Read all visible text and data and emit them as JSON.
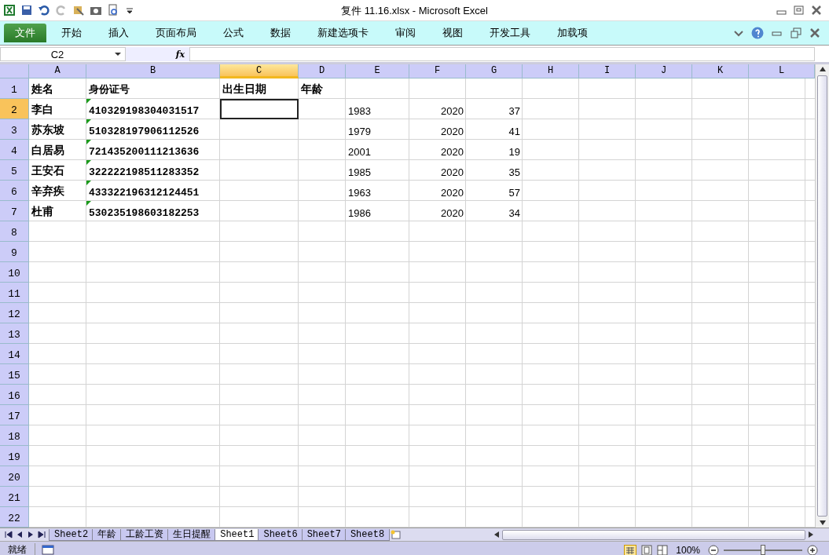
{
  "window": {
    "title": "复件 11.16.xlsx  -  Microsoft Excel"
  },
  "ribbon_tabs": [
    {
      "label": "文件",
      "kind": "file",
      "selected": false
    },
    {
      "label": "开始",
      "kind": "tab",
      "selected": false
    },
    {
      "label": "插入",
      "kind": "tab",
      "selected": false
    },
    {
      "label": "页面布局",
      "kind": "tab",
      "selected": false
    },
    {
      "label": "公式",
      "kind": "tab",
      "selected": false
    },
    {
      "label": "数据",
      "kind": "tab",
      "selected": false
    },
    {
      "label": "新建选项卡",
      "kind": "tab",
      "selected": false
    },
    {
      "label": "审阅",
      "kind": "tab",
      "selected": false
    },
    {
      "label": "视图",
      "kind": "tab",
      "selected": false
    },
    {
      "label": "开发工具",
      "kind": "tab",
      "selected": false
    },
    {
      "label": "加载项",
      "kind": "tab",
      "selected": false
    }
  ],
  "formula_bar": {
    "name_box": "C2",
    "function_symbol": "fx"
  },
  "columns": [
    {
      "label": "A",
      "selected": false
    },
    {
      "label": "B",
      "selected": false
    },
    {
      "label": "C",
      "selected": true
    },
    {
      "label": "D",
      "selected": false
    },
    {
      "label": "E",
      "selected": false
    },
    {
      "label": "F",
      "selected": false
    },
    {
      "label": "G",
      "selected": false
    },
    {
      "label": "H",
      "selected": false
    },
    {
      "label": "I",
      "selected": false
    },
    {
      "label": "J",
      "selected": false
    },
    {
      "label": "K",
      "selected": false
    },
    {
      "label": "L",
      "selected": false
    }
  ],
  "rows": [
    {
      "header": "1",
      "selected": false,
      "name": "姓名",
      "id_number": "身份证号",
      "birth_date": "出生日期",
      "age": "年龄"
    },
    {
      "header": "2",
      "selected": true,
      "name": "李白",
      "id_number": "410329198304031517",
      "id_flagged": true,
      "column_e": "1983",
      "column_f": "2020",
      "column_g": "37"
    },
    {
      "header": "3",
      "selected": false,
      "name": "苏东坡",
      "id_number": "510328197906112526",
      "id_flagged": true,
      "column_e": "1979",
      "column_f": "2020",
      "column_g": "41"
    },
    {
      "header": "4",
      "selected": false,
      "name": "白居易",
      "id_number": "721435200111213636",
      "id_flagged": true,
      "column_e": "2001",
      "column_f": "2020",
      "column_g": "19"
    },
    {
      "header": "5",
      "selected": false,
      "name": "王安石",
      "id_number": "322222198511283352",
      "id_flagged": true,
      "column_e": "1985",
      "column_f": "2020",
      "column_g": "35"
    },
    {
      "header": "6",
      "selected": false,
      "name": "辛弃疾",
      "id_number": "433322196312124451",
      "id_flagged": true,
      "column_e": "1963",
      "column_f": "2020",
      "column_g": "57"
    },
    {
      "header": "7",
      "selected": false,
      "name": "杜甫",
      "id_number": "530235198603182253",
      "id_flagged": true,
      "column_e": "1986",
      "column_f": "2020",
      "column_g": "34"
    },
    {
      "header": "8",
      "selected": false
    },
    {
      "header": "9",
      "selected": false
    },
    {
      "header": "10",
      "selected": false
    },
    {
      "header": "11",
      "selected": false
    },
    {
      "header": "12",
      "selected": false
    },
    {
      "header": "13",
      "selected": false
    },
    {
      "header": "14",
      "selected": false
    },
    {
      "header": "15",
      "selected": false
    },
    {
      "header": "16",
      "selected": false
    },
    {
      "header": "17",
      "selected": false
    },
    {
      "header": "18",
      "selected": false
    },
    {
      "header": "19",
      "selected": false
    },
    {
      "header": "20",
      "selected": false
    },
    {
      "header": "21",
      "selected": false
    },
    {
      "header": "22",
      "selected": false
    }
  ],
  "sheet_tabs": [
    {
      "label": "Sheet2",
      "selected": false
    },
    {
      "label": "年龄",
      "selected": false
    },
    {
      "label": "工龄工资",
      "selected": false
    },
    {
      "label": "生日提醒",
      "selected": false
    },
    {
      "label": "Sheet1",
      "selected": true
    },
    {
      "label": "Sheet6",
      "selected": false
    },
    {
      "label": "Sheet7",
      "selected": false
    },
    {
      "label": "Sheet8",
      "selected": false
    }
  ],
  "status_bar": {
    "status": "就绪",
    "zoom": "100%",
    "zoom_slider": {
      "level": 0.5
    }
  }
}
